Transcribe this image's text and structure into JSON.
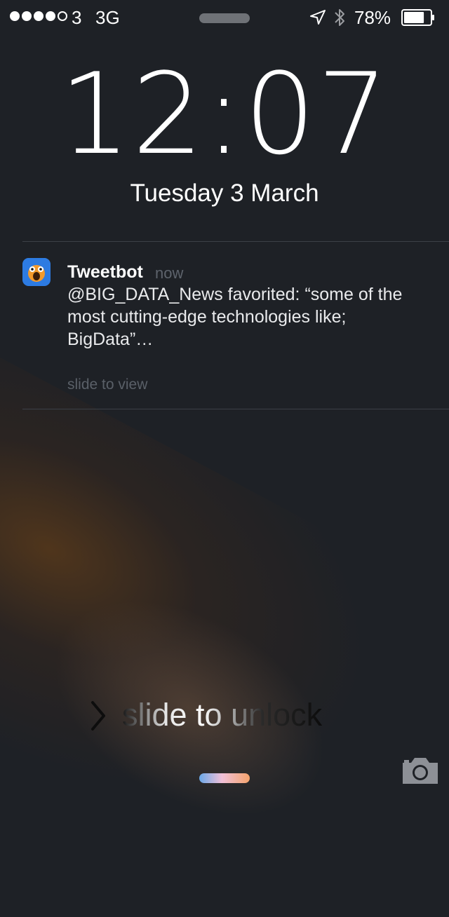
{
  "status_bar": {
    "signal_bars_filled": 4,
    "signal_bars_total": 5,
    "carrier": "3",
    "network": "3G",
    "location_icon": "location-arrow-icon",
    "bluetooth_icon": "bluetooth-icon",
    "battery_percent_label": "78%",
    "battery_level": 0.78
  },
  "lock": {
    "time": "12:07",
    "date": "Tuesday 3 March"
  },
  "notification": {
    "app": "Tweetbot",
    "time": "now",
    "body": "@BIG_DATA_News favorited: “some of the most cutting-edge technologies like; BigData”…",
    "hint": "slide to view"
  },
  "unlock": {
    "label": "slide to unlock",
    "camera_icon": "camera-icon"
  },
  "colors": {
    "background": "#1e2126",
    "divider": "#3c4047",
    "muted_text": "#5a6068"
  }
}
